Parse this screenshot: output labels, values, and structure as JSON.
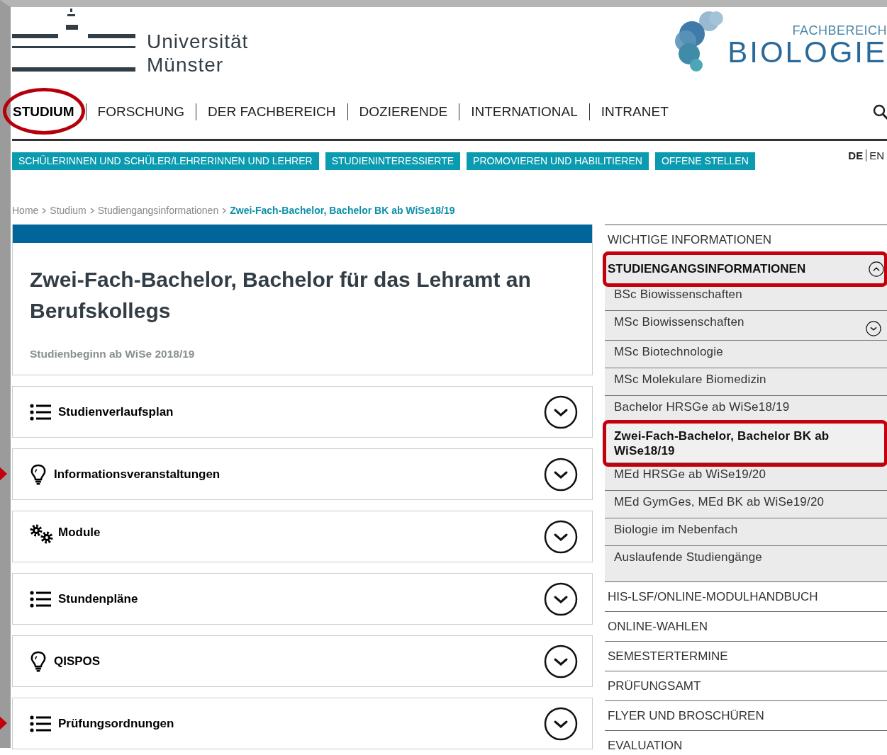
{
  "header": {
    "university_logo": [
      "Universität",
      "Münster"
    ],
    "department_logo": {
      "overline": "FACHBEREICH",
      "name": "BIOLOGIE"
    }
  },
  "main_nav": [
    {
      "label": "STUDIUM",
      "selected": true,
      "highlighted": true
    },
    {
      "label": "FORSCHUNG",
      "selected": false,
      "highlighted": false
    },
    {
      "label": "DER FACHBEREICH",
      "selected": false,
      "highlighted": false
    },
    {
      "label": "DOZIERENDE",
      "selected": false,
      "highlighted": false
    },
    {
      "label": "INTERNATIONAL",
      "selected": false,
      "highlighted": false
    },
    {
      "label": "INTRANET",
      "selected": false,
      "highlighted": false
    }
  ],
  "sub_nav": [
    "SCHÜLERINNEN UND SCHÜLER/LEHRERINNEN UND LEHRER",
    "STUDIENINTERESSIERTE",
    "PROMOVIEREN UND HABILITIEREN",
    "OFFENE STELLEN"
  ],
  "languages": [
    {
      "label": "DE",
      "selected": true
    },
    {
      "label": "EN",
      "selected": false
    }
  ],
  "breadcrumb": [
    {
      "label": "Home",
      "current": false
    },
    {
      "label": "Studium",
      "current": false
    },
    {
      "label": "Studiengangsinformationen",
      "current": false
    },
    {
      "label": "Zwei-Fach-Bachelor, Bachelor BK ab WiSe18/19",
      "current": true
    }
  ],
  "page_header": {
    "title": "Zwei-Fach-Bachelor, Bachelor für das Lehramt an Berufskollegs",
    "subtitle": "Studienbeginn ab WiSe 2018/19"
  },
  "accordion": [
    {
      "kind": "list",
      "label": "Studienverlaufsplan",
      "expanded": false,
      "pointer": false
    },
    {
      "kind": "bulb",
      "label": "Informationsveranstaltungen",
      "expanded": false,
      "pointer": true
    },
    {
      "kind": "gears",
      "label": "Module",
      "expanded": false,
      "pointer": false
    },
    {
      "kind": "list",
      "label": "Stundenpläne",
      "expanded": false,
      "pointer": false
    },
    {
      "kind": "bulb",
      "label": "QISPOS",
      "expanded": false,
      "pointer": false
    },
    {
      "kind": "list",
      "label": "Prüfungsordnungen",
      "expanded": false,
      "pointer": true
    }
  ],
  "sidebar": [
    {
      "label": "WICHTIGE INFORMATIONEN",
      "expanded": false,
      "highlighted": false
    },
    {
      "label": "STUDIENGANGSINFORMATIONEN",
      "expanded": true,
      "highlighted": true,
      "children": [
        {
          "label": "BSc Biowissenschaften",
          "selected": false,
          "highlighted": false,
          "has_children": false
        },
        {
          "label": "MSc Biowissenschaften",
          "selected": false,
          "highlighted": false,
          "has_children": true
        },
        {
          "label": "MSc Biotechnologie",
          "selected": false,
          "highlighted": false,
          "has_children": false
        },
        {
          "label": "MSc Molekulare Biomedizin",
          "selected": false,
          "highlighted": false,
          "has_children": false
        },
        {
          "label": "Bachelor HRSGe ab WiSe18/19",
          "selected": false,
          "highlighted": false,
          "has_children": false
        },
        {
          "label": "Zwei-Fach-Bachelor, Bachelor BK ab WiSe18/19",
          "selected": true,
          "highlighted": true,
          "has_children": false
        },
        {
          "label": "MEd HRSGe ab WiSe19/20",
          "selected": false,
          "highlighted": false,
          "has_children": false
        },
        {
          "label": "MEd GymGes, MEd BK ab WiSe19/20",
          "selected": false,
          "highlighted": false,
          "has_children": false
        },
        {
          "label": "Biologie im Nebenfach",
          "selected": false,
          "highlighted": false,
          "has_children": false
        },
        {
          "label": "Auslaufende Studiengänge",
          "selected": false,
          "highlighted": false,
          "has_children": false
        }
      ]
    },
    {
      "label": "HIS-LSF/ONLINE-MODULHANDBUCH",
      "expanded": false,
      "highlighted": false
    },
    {
      "label": "ONLINE-WAHLEN",
      "expanded": false,
      "highlighted": false
    },
    {
      "label": "SEMESTERTERMINE",
      "expanded": false,
      "highlighted": false
    },
    {
      "label": "PRÜFUNGSAMT",
      "expanded": false,
      "highlighted": false
    },
    {
      "label": "FLYER UND BROSCHÜREN",
      "expanded": false,
      "highlighted": false
    },
    {
      "label": "EVALUATION",
      "expanded": false,
      "highlighted": false
    }
  ]
}
